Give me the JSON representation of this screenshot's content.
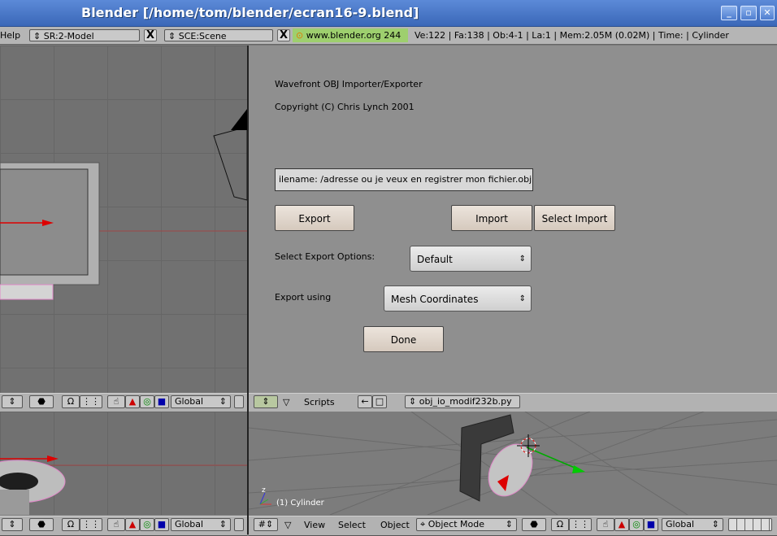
{
  "window": {
    "title": "Blender [/home/tom/blender/ecran16-9.blend]",
    "buttons": {
      "minimize": "_",
      "maximize": "▫",
      "close": "✕"
    }
  },
  "infobar": {
    "help_menu": "Help",
    "screen_selector": "SR:2-Model",
    "scene_selector": "SCE:Scene",
    "website": "www.blender.org 244",
    "stats": "Ve:122 | Fa:138 | Ob:4-1 | La:1  | Mem:2.05M (0.02M)  | Time: | Cylinder",
    "close_x": "X"
  },
  "script_panel": {
    "line1": "Wavefront OBJ Importer/Exporter",
    "line2": "Copyright (C) Chris Lynch 2001",
    "filename_value": "ilename: /adresse ou je veux en registrer mon fichier.obj",
    "export_button": "Export",
    "import_button": "Import",
    "select_import_button": "Select Import",
    "export_options_label": "Select Export Options:",
    "export_options_value": "Default",
    "export_using_label": "Export using",
    "export_using_value": "Mesh Coordinates",
    "done_button": "Done"
  },
  "script_header": {
    "menu_label": "Scripts",
    "script_name": "obj_io_modif232b.py"
  },
  "view3d_header_left": {
    "orientation": "Global"
  },
  "view3d_header_right": {
    "menu_view": "View",
    "menu_select": "Select",
    "menu_object": "Object",
    "mode": "Object Mode",
    "orientation": "Global"
  },
  "viewport_bottom_right": {
    "object_label": "(1) Cylinder",
    "axis_z": "z"
  },
  "colors": {
    "titlebar": "#3a67b8",
    "viewport": "#717171",
    "panel": "#8f8f8f",
    "button": "#d5c9bd",
    "website_highlight": "#9ecf6e"
  }
}
